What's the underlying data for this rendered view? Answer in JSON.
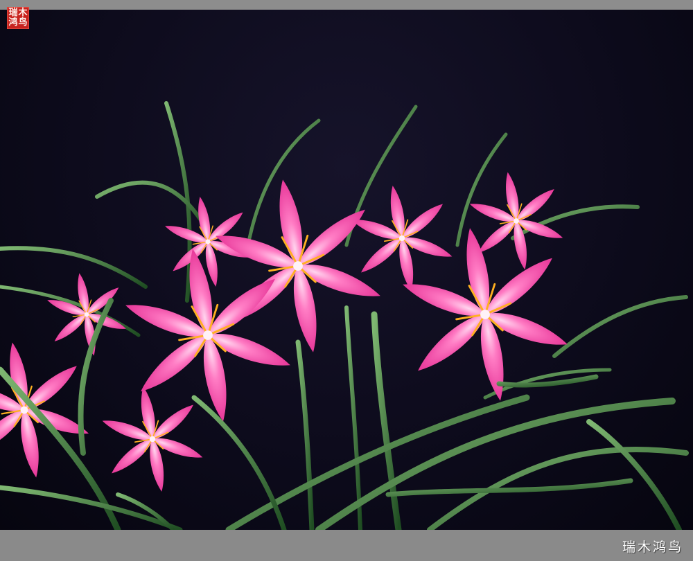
{
  "photo": {
    "subject": "pink-rain-lily-flowers",
    "background_color": "#0d0b1c",
    "petal_color": "#ff6fb8",
    "leaf_color": "#3f8a3a"
  },
  "seal": {
    "chars": [
      "瑞",
      "木",
      "鸿",
      "鸟"
    ]
  },
  "signature": "瑞木鸿鸟",
  "frame": {
    "color": "#8a8a8a"
  }
}
